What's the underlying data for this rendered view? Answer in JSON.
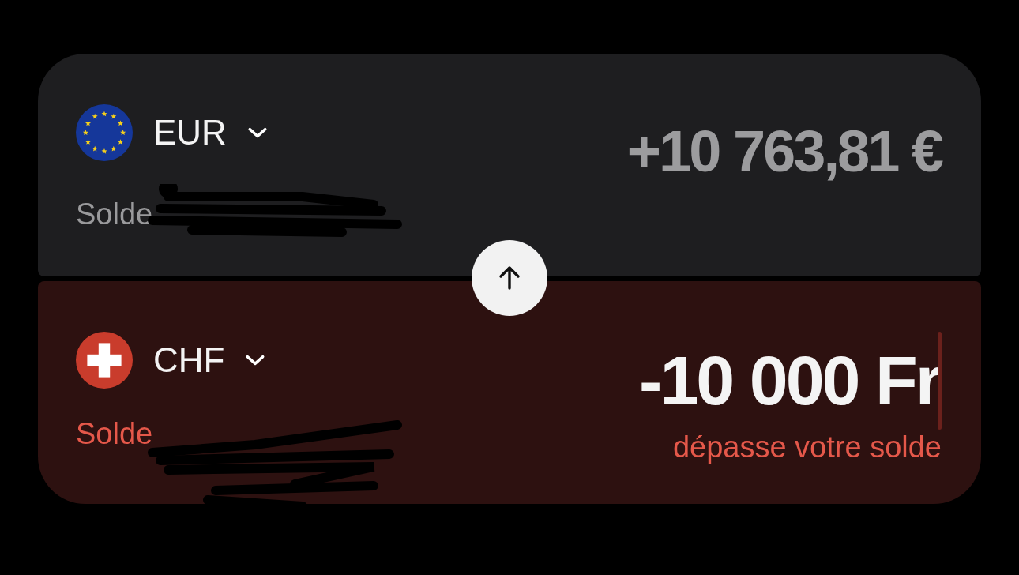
{
  "accounts": [
    {
      "currency": "EUR",
      "kind": "eu",
      "balance_label": "Solde",
      "amount": "+10 763,81 €",
      "focused": false,
      "error": false
    },
    {
      "currency": "CHF",
      "kind": "ch",
      "balance_label": "Solde",
      "amount": "-10 000 Fr",
      "focused": true,
      "error": true,
      "note": "dépasse votre solde"
    }
  ]
}
